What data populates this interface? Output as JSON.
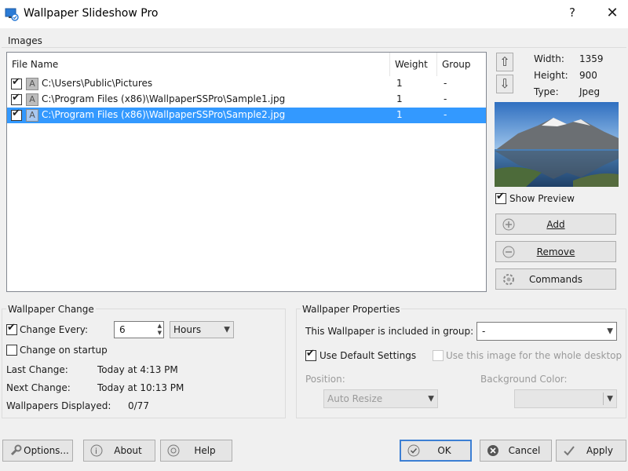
{
  "window": {
    "title": "Wallpaper Slideshow Pro",
    "help": "?",
    "close": "✕"
  },
  "images": {
    "group_label": "Images",
    "columns": [
      "File Name",
      "Weight",
      "Group"
    ],
    "rows": [
      {
        "path": "C:\\Users\\Public\\Pictures",
        "weight": "1",
        "group": "-",
        "checked": true,
        "selected": false
      },
      {
        "path": "C:\\Program Files (x86)\\WallpaperSSPro\\Sample1.jpg",
        "weight": "1",
        "group": "-",
        "checked": true,
        "selected": false
      },
      {
        "path": "C:\\Program Files (x86)\\WallpaperSSPro\\Sample2.jpg",
        "weight": "1",
        "group": "-",
        "checked": true,
        "selected": true
      }
    ]
  },
  "info": {
    "width_label": "Width:",
    "width": "1359",
    "height_label": "Height:",
    "height": "900",
    "type_label": "Type:",
    "type": "Jpeg"
  },
  "preview": {
    "show_label": "Show Preview",
    "checked": true
  },
  "side_buttons": {
    "add": "Add",
    "remove": "Remove",
    "commands": "Commands"
  },
  "change": {
    "group_label": "Wallpaper Change",
    "every_label": "Change Every:",
    "every_value": "6",
    "unit": "Hours",
    "startup_label": "Change on startup",
    "last_label": "Last Change:",
    "last_value": "Today at 4:13 PM",
    "next_label": "Next Change:",
    "next_value": "Today at 10:13 PM",
    "displayed_label": "Wallpapers Displayed:",
    "displayed_value": "0/77"
  },
  "props": {
    "group_label": "Wallpaper Properties",
    "included_label": "This Wallpaper is included in group:",
    "included_value": "-",
    "default_label": "Use Default Settings",
    "whole_label": "Use this image for the whole desktop",
    "position_label": "Position:",
    "position_value": "Auto Resize",
    "bg_label": "Background Color:"
  },
  "footer": {
    "options": "Options...",
    "about": "About",
    "help": "Help",
    "ok": "OK",
    "cancel": "Cancel",
    "apply": "Apply"
  }
}
